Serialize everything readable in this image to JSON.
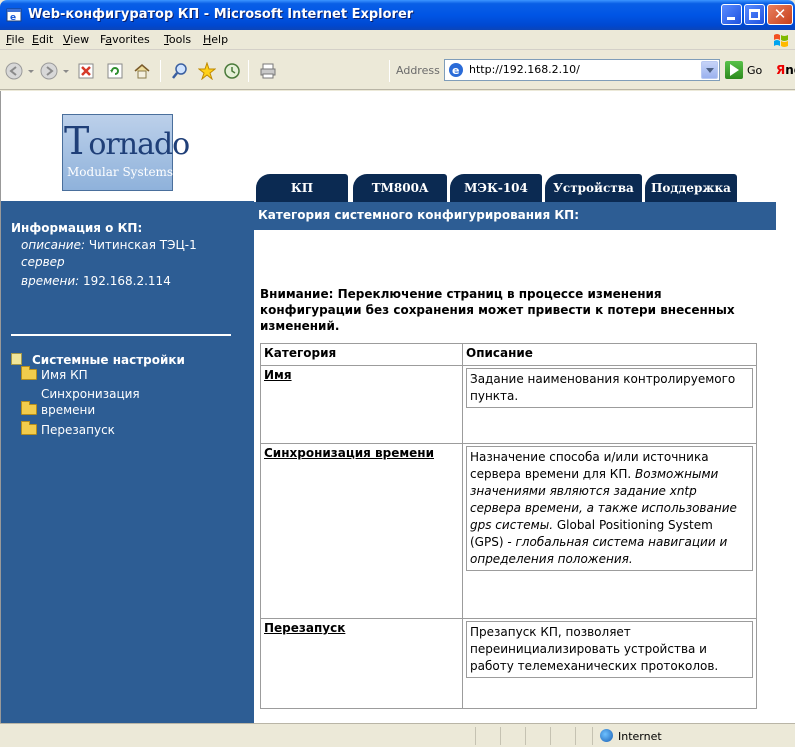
{
  "window": {
    "title": "Web-конфигуратор КП - Microsoft Internet Explorer"
  },
  "menu": {
    "items": [
      {
        "label": "File",
        "u": "F",
        "rest": "ile"
      },
      {
        "label": "Edit",
        "u": "E",
        "rest": "dit"
      },
      {
        "label": "View",
        "u": "V",
        "rest": "iew"
      },
      {
        "label": "Favorites",
        "u": "a",
        "pre": "F",
        "rest": "vorites"
      },
      {
        "label": "Tools",
        "u": "T",
        "rest": "ools"
      },
      {
        "label": "Help",
        "u": "H",
        "rest": "elp"
      }
    ]
  },
  "toolbar": {
    "address_label": "Address",
    "url": "http://192.168.2.10/",
    "go_label": "Go",
    "search_brand_first": "Я",
    "search_brand_rest": "ndex"
  },
  "logo": {
    "text_first": "T",
    "text_rest": "ornado",
    "subtitle": "Modular Systems"
  },
  "tabs": [
    {
      "label": "КП"
    },
    {
      "label": "TM800A"
    },
    {
      "label": "МЭК-104"
    },
    {
      "label": "Устройства"
    },
    {
      "label": "Поддержка"
    }
  ],
  "sidebar": {
    "info_title": "Информация о КП:",
    "description_key": "описание:",
    "description_value": "Читинская ТЭЦ-1",
    "server_key_line1": "сервер",
    "server_key_line2": "времени:",
    "server_value": "192.168.2.114",
    "tree_root": "Системные настройки",
    "tree_items": [
      {
        "label": "Имя КП"
      },
      {
        "label_line1": "Синхронизация",
        "label_line2": "времени"
      },
      {
        "label": "Перезапуск"
      }
    ]
  },
  "main": {
    "header": "Категория системного конфигурирования КП:",
    "warning": "Внимание: Переключение страниц в процессе изменения конфигурации без сохранения может привести к потери внесенных изменений.",
    "table": {
      "col_category": "Категория",
      "col_description": "Описание",
      "rows": [
        {
          "name": "Имя",
          "desc": "Задание наименования контролируемого пункта."
        },
        {
          "name": "Синхронизация времени",
          "desc": "Назначение способа и/или источника сервера времени для КП.",
          "desc_italic": "Возможными значениями являются задание xntp сервера времени, а также использование gps системы.",
          "desc_extra": "Global Positioning System (GPS) -",
          "desc_italic2": "глобальная система навигации и определения положения."
        },
        {
          "name": "Перезапуск",
          "desc": "Презапуск КП, позволяет переинициализировать устройства и работу телемеханических протоколов."
        }
      ]
    }
  },
  "status": {
    "zone": "Internet"
  }
}
